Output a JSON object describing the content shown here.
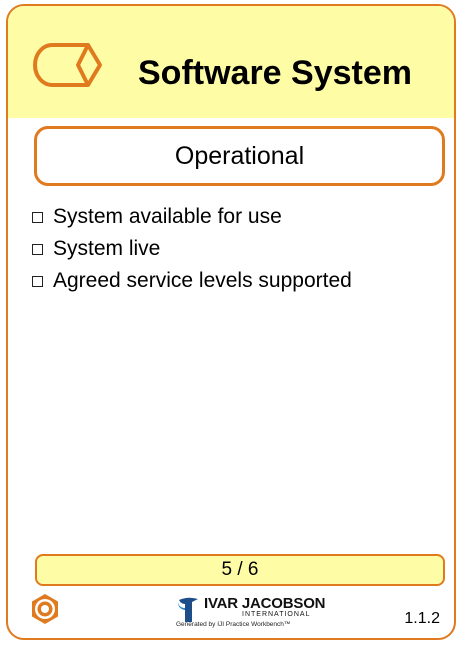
{
  "card": {
    "title": "Software System",
    "state": "Operational",
    "checklist": [
      "System available for use",
      "System live",
      "Agreed service levels supported"
    ],
    "progress": "5 / 6",
    "version": "1.1.2",
    "logo": {
      "name": "IVAR JACOBSON",
      "sub": "INTERNATIONAL",
      "generated": "Generated by IJI Practice Workbench™"
    }
  },
  "colors": {
    "accent": "#e07a1f",
    "header_bg": "#fffca6",
    "logo_blue": "#1d4e89"
  },
  "icons": [
    "alpha-icon",
    "gear-icon",
    "ivar-jacobson-logo-icon"
  ]
}
